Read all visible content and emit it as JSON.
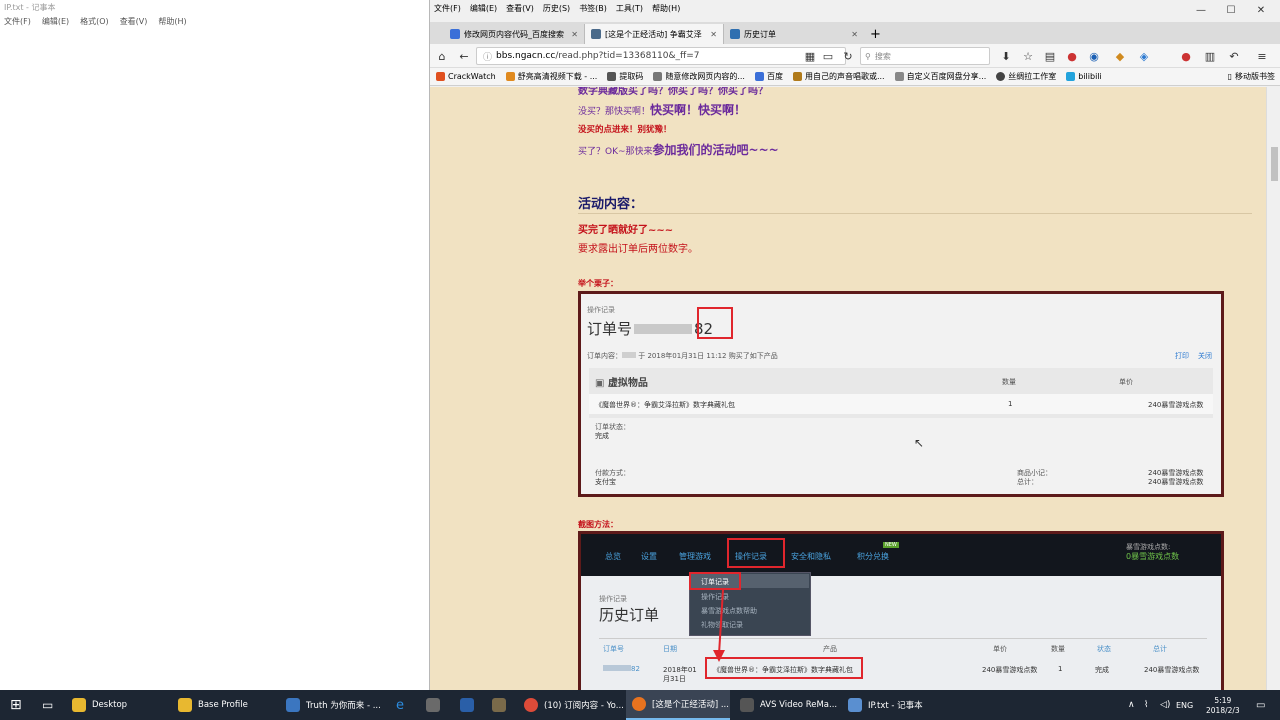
{
  "notepad": {
    "title": "IP.txt - 记事本",
    "menu": [
      "文件(F)",
      "编辑(E)",
      "格式(O)",
      "查看(V)",
      "帮助(H)"
    ]
  },
  "firefox": {
    "menu": [
      "文件(F)",
      "编辑(E)",
      "查看(V)",
      "历史(S)",
      "书签(B)",
      "工具(T)",
      "帮助(H)"
    ],
    "tabs": [
      {
        "label": "修改网页内容代码_百度搜索",
        "color": "#3b6fd8"
      },
      {
        "label": "[这是个正经活动] 争霸艾泽",
        "color": "#4a6a8a"
      },
      {
        "label": "历史订单",
        "color": "#2f6fb0"
      }
    ],
    "new_tab": "+",
    "url_host": "bbs.ngacn.cc",
    "url_path": "/read.php?tid=13368110&_ff=7",
    "search_placeholder": "搜索",
    "bookmarks": [
      {
        "label": "CrackWatch",
        "color": "#e0501f"
      },
      {
        "label": "舒亮高清视频下载 - ...",
        "color": "#e08a1f"
      },
      {
        "label": "提取码",
        "color": "#555555"
      },
      {
        "label": "随意修改网页内容的...",
        "color": "#777777"
      },
      {
        "label": "百度",
        "color": "#3b6fd8"
      },
      {
        "label": "用自己的声音唱歌或...",
        "color": "#b07a1a"
      },
      {
        "label": "自定义百度网盘分享...",
        "color": "#888888"
      },
      {
        "label": "丝绸拉工作室",
        "color": "#444444"
      },
      {
        "label": "bilibili",
        "color": "#23a3dc"
      }
    ],
    "bookmarks_mobile": "移动版书签"
  },
  "post": {
    "line0": "数字典藏版买了吗？你买了吗？你买了吗？",
    "line1a": "没买？那快买啊！",
    "line1b": "快买啊！快买啊！",
    "line2": "没买的点进来！别犹豫！",
    "line3a": "买了？OK~那快来",
    "line3b": "参加我们的活动吧~~~",
    "section_title": "活动内容：",
    "content1": "买完了晒就好了~~~",
    "content2": "要求露出订单后两位数字。",
    "example_label": "举个栗子：",
    "method_label": "截图方法："
  },
  "order": {
    "breadcrumb": "操作记录",
    "title": "订单号",
    "number_suffix": "82",
    "info_prefix": "订单内容：",
    "info": "于 2018年01月31日 11:12 购买了如下产品",
    "print": "打印",
    "close": "关闭",
    "section": "虚拟物品",
    "col_qty": "数量",
    "col_price": "单价",
    "item": "《魔兽世界®：争霸艾泽拉斯》数字典藏礼包",
    "qty": "1",
    "price": "240暴雪游戏点数",
    "status_label": "订单状态：",
    "status": "完成",
    "pay_label": "付款方式：",
    "pay": "支付宝",
    "subtotal_label": "商品小记：",
    "total_label": "总计：",
    "subtotal": "240暴雪游戏点数",
    "total": "240暴雪游戏点数"
  },
  "bnet": {
    "nav": [
      "总览",
      "设置",
      "管理游戏",
      "操作记录",
      "安全和隐私",
      "积分兑换"
    ],
    "new_badge": "NEW",
    "points_label": "暴雪游戏点数:",
    "points": "0暴雪游戏点数",
    "dropdown": [
      "订单记录",
      "操作记录",
      "暴雪游戏点数帮助",
      "礼物领取记录"
    ],
    "breadcrumb": "操作记录",
    "title": "历史订单",
    "cols": [
      "订单号",
      "日期",
      "产品",
      "单价",
      "数量",
      "状态",
      "总计"
    ],
    "row": {
      "id": "82",
      "date1": "2018年01",
      "date2": "月31日",
      "product": "《魔兽世界®：争霸艾泽拉斯》数字典藏礼包",
      "price": "240暴雪游戏点数",
      "qty": "1",
      "status": "完成",
      "total": "240暴雪游戏点数"
    }
  },
  "taskbar": {
    "items": [
      {
        "label": "Desktop",
        "color": "#e8b830"
      },
      {
        "label": "Base Profile",
        "color": "#e8b830"
      },
      {
        "label": "Truth  为你而来 - ...",
        "color": "#3b76c0"
      },
      {
        "label": "(10) 订阅内容 - Yo...",
        "color": "#dd4b39"
      },
      {
        "label": "[这是个正经活动] ...",
        "color": "#e8731f"
      },
      {
        "label": "AVS Video ReMa...",
        "color": "#555555"
      },
      {
        "label": "IP.txt - 记事本",
        "color": "#5a8fd0"
      }
    ],
    "lang": "ENG",
    "time": "5:19",
    "date": "2018/2/3"
  }
}
